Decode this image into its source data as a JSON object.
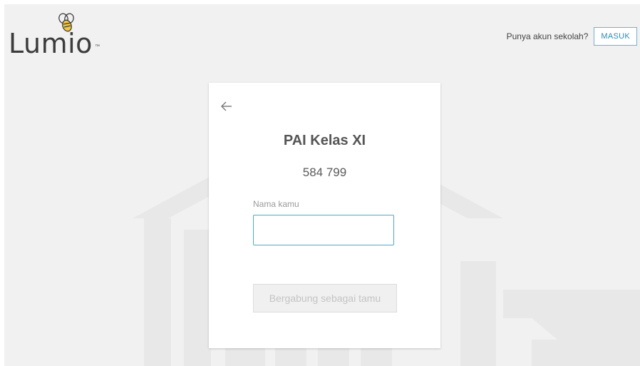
{
  "brand": {
    "name": "Lumio",
    "trademark": "™",
    "icon": "bee-icon"
  },
  "header": {
    "account_prompt": "Punya akun sekolah?",
    "login_label": "MASUK"
  },
  "card": {
    "back_icon": "arrow-left-icon",
    "title": "PAI Kelas XI",
    "code": "584 799",
    "name_label": "Nama kamu",
    "name_value": "",
    "name_placeholder": "",
    "join_button_label": "Bergabung sebagai tamu",
    "join_button_disabled": true
  },
  "colors": {
    "accent": "#2a8ab4",
    "input_focus_border": "#4fa8cc",
    "background": "#f1f1f1",
    "disabled_text": "#c4c4c4"
  }
}
